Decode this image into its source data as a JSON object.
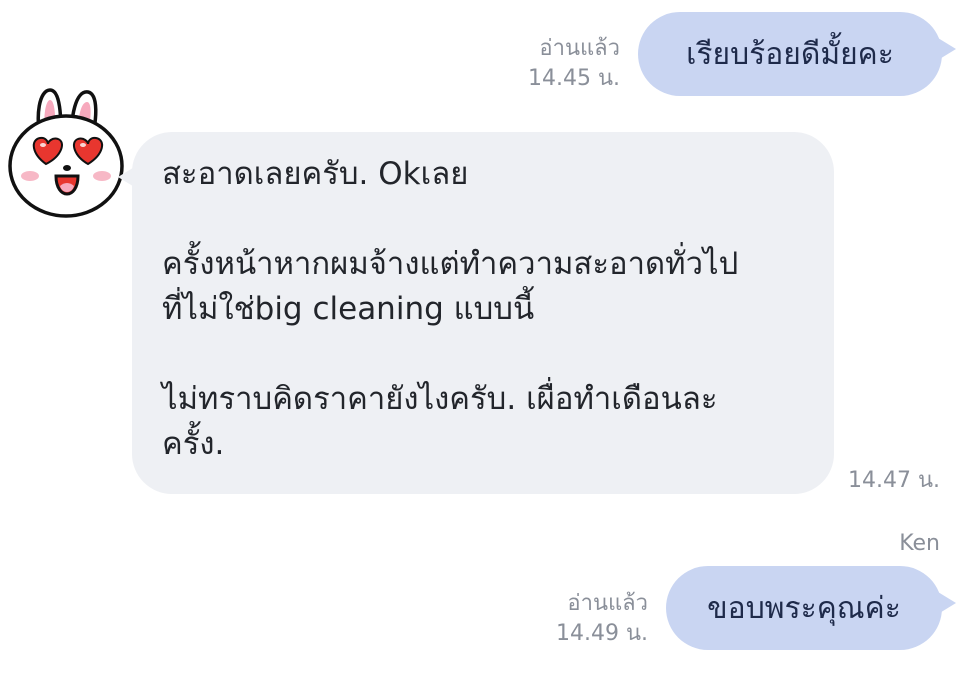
{
  "messages": [
    {
      "direction": "outgoing",
      "read_label": "อ่านแล้ว",
      "time": "14.45 น.",
      "text": "เรียบร้อยดีมั้ยคะ"
    },
    {
      "direction": "incoming",
      "avatar": "cony-rabbit-heart-eyes-sticker",
      "text": "สะอาดเลยครับ. Okเลย\n\nครั้งหน้าหากผมจ้างแต่ทำความสะอาดทั่วไป\nที่ไม่ใช่big cleaning แบบนี้\n\nไม่ทราบคิดราคายังไงครับ. เผื่อทำเดือนละ\nครั้ง.",
      "time": "14.47 น."
    },
    {
      "direction": "outgoing",
      "sender": "Ken",
      "read_label": "อ่านแล้ว",
      "time": "14.49 น.",
      "text": "ขอบพระคุณค่ะ"
    }
  ],
  "colors": {
    "outgoing_bubble": "#c9d5f2",
    "incoming_bubble": "#eef0f4",
    "meta_text": "#8a8f99"
  }
}
